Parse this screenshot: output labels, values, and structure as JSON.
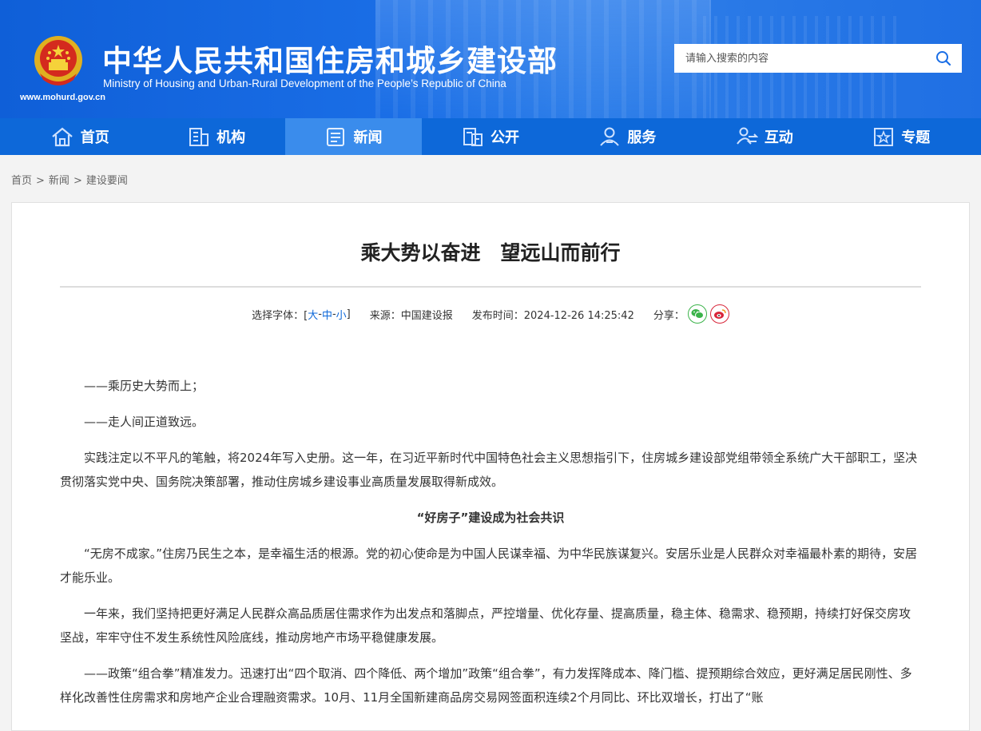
{
  "header": {
    "title_cn": "中华人民共和国住房和城乡建设部",
    "title_en": "Ministry of Housing and Urban-Rural Development of the People’s Republic of China",
    "url": "www.mohurd.gov.cn",
    "brand_color": "#0d68d9"
  },
  "search": {
    "placeholder": "请输入搜索的内容",
    "icon": "search-icon"
  },
  "nav": {
    "items": [
      {
        "label": "首页",
        "icon": "home-icon"
      },
      {
        "label": "机构",
        "icon": "building-icon"
      },
      {
        "label": "新闻",
        "icon": "news-icon",
        "active": true
      },
      {
        "label": "公开",
        "icon": "document-icon"
      },
      {
        "label": "服务",
        "icon": "user-service-icon"
      },
      {
        "label": "互动",
        "icon": "interaction-icon"
      },
      {
        "label": "专题",
        "icon": "star-icon"
      }
    ]
  },
  "breadcrumb": {
    "items": [
      "首页",
      "新闻",
      "建设要闻"
    ],
    "separator": ">"
  },
  "article": {
    "title": "乘大势以奋进　望远山而前行",
    "meta": {
      "font_label": "选择字体：[",
      "font_large": "大",
      "font_medium": "中",
      "font_small": "小",
      "font_dash": "-",
      "font_close": "]",
      "source": "来源：中国建设报",
      "published": "发布时间：2024-12-26 14:25:42",
      "share_label": "分享："
    },
    "paragraphs": [
      "——乘历史大势而上；",
      "——走人间正道致远。",
      "实践注定以不平凡的笔触，将2024年写入史册。这一年，在习近平新时代中国特色社会主义思想指引下，住房城乡建设部党组带领全系统广大干部职工，坚决贯彻落实党中央、国务院决策部署，推动住房城乡建设事业高质量发展取得新成效。"
    ],
    "subheading": "“好房子”建设成为社会共识",
    "paragraphs2": [
      "“无房不成家。”住房乃民生之本，是幸福生活的根源。党的初心使命是为中国人民谋幸福、为中华民族谋复兴。安居乐业是人民群众对幸福最朴素的期待，安居才能乐业。",
      "一年来，我们坚持把更好满足人民群众高品质居住需求作为出发点和落脚点，严控增量、优化存量、提高质量，稳主体、稳需求、稳预期，持续打好保交房攻坚战，牢牢守住不发生系统性风险底线，推动房地产市场平稳健康发展。",
      "——政策“组合拳”精准发力。迅速打出“四个取消、四个降低、两个增加”政策“组合拳”，有力发挥降成本、降门槛、提预期综合效应，更好满足居民刚性、多样化改善性住房需求和房地产企业合理融资需求。10月、11月全国新建商品房交易网签面积连续2个月同比、环比双增长，打出了“账"
    ]
  }
}
